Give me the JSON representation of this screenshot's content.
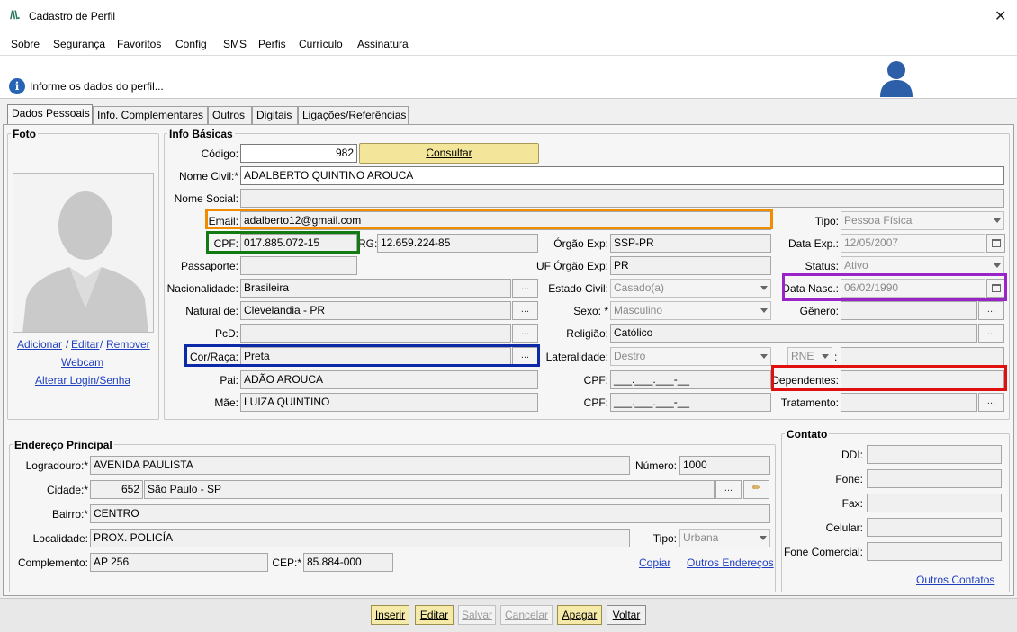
{
  "window": {
    "title": "Cadastro de Perfil",
    "logo": "/\\\\."
  },
  "menu": [
    "Sobre",
    "Segurança",
    "Favoritos",
    "Config",
    "SMS",
    "Perfis",
    "Currículo",
    "Assinatura"
  ],
  "info": {
    "text": "Informe os dados do perfil..."
  },
  "tabs": [
    "Dados Pessoais",
    "Info. Complementares",
    "Outros",
    "Digitais",
    "Ligações/Referências"
  ],
  "foto": {
    "title": "Foto",
    "add": "Adicionar",
    "sep1": "/",
    "edit": "Editar",
    "sep2": "/",
    "remove": "Remover",
    "webcam": "Webcam",
    "change_login": "Alterar Login/Senha"
  },
  "basic": {
    "title": "Info Básicas",
    "codigo_label": "Código:",
    "codigo": "982",
    "consultar": "Consultar",
    "nome_civil_label": "Nome Civil:*",
    "nome_civil": "ADALBERTO QUINTINO AROUCA",
    "nome_social_label": "Nome Social:",
    "nome_social": "",
    "email_label": "Email:",
    "email": "adalberto12@gmail.com",
    "cpf_label": "CPF:",
    "cpf": "017.885.072-15",
    "rg_label": "RG:",
    "rg": "12.659.224-85",
    "passaporte_label": "Passaporte:",
    "passaporte": "",
    "nacionalidade_label": "Nacionalidade:",
    "nacionalidade": "Brasileira",
    "natural_label": "Natural de:",
    "natural": "Clevelandia - PR",
    "pcd_label": "PcD:",
    "pcd": "",
    "cor_label": "Cor/Raça:",
    "cor": "Preta",
    "pai_label": "Pai:",
    "pai": "ADÃO AROUCA",
    "mae_label": "Mãe:",
    "mae": "LUIZA QUINTINO",
    "orgao_label": "Órgão Exp:",
    "orgao": "SSP-PR",
    "uf_label": "UF Órgão Exp:",
    "uf": "PR",
    "estado_civil_label": "Estado Civil:",
    "estado_civil": "Casado(a)",
    "sexo_label": "Sexo: *",
    "sexo": "Masculino",
    "religiao_label": "Religião:",
    "religiao": "Católico",
    "lateralidade_label": "Lateralidade:",
    "lateralidade": "Destro",
    "cpf_pai_label": "CPF:",
    "cpf_pai": "___.___.___-__",
    "cpf_mae_label": "CPF:",
    "cpf_mae": "___.___.___-__",
    "tipo_label": "Tipo:",
    "tipo": "Pessoa Física",
    "data_exp_label": "Data Exp.:",
    "data_exp": "12/05/2007",
    "status_label": "Status:",
    "status": "Ativo",
    "data_nasc_label": "Data Nasc.:",
    "data_nasc": "06/02/1990",
    "genero_label": "Gênero:",
    "genero": "",
    "rne": "RNE",
    "rne_colon": ":",
    "rne_value": "",
    "dependentes_label": "Dependentes:",
    "dependentes": "",
    "tratamento_label": "Tratamento:",
    "tratamento": ""
  },
  "dots": "...",
  "address": {
    "title": "Endereço Principal",
    "logradouro_label": "Logradouro:*",
    "logradouro": "AVENIDA PAULISTA",
    "numero_label": "Número:",
    "numero": "1000",
    "cidade_label": "Cidade:*",
    "cidade_code": "652",
    "cidade": "São Paulo - SP",
    "bairro_label": "Bairro:*",
    "bairro": "CENTRO",
    "localidade_label": "Localidade:",
    "localidade": "PROX. POLICÍA",
    "tipo_label": "Tipo:",
    "tipo": "Urbana",
    "complemento_label": "Complemento:",
    "complemento": "AP 256",
    "cep_label": "CEP:*",
    "cep": "85.884-000",
    "copiar": "Copiar",
    "outros_enderecos": "Outros Endereços"
  },
  "contact": {
    "title": "Contato",
    "ddi_label": "DDI:",
    "fone_label": "Fone:",
    "fax_label": "Fax:",
    "celular_label": "Celular:",
    "fone_com_label": "Fone Comercial:",
    "outros_contatos": "Outros Contatos"
  },
  "buttons": {
    "inserir": "Inserir",
    "editar": "Editar",
    "salvar": "Salvar",
    "cancelar": "Cancelar",
    "apagar": "Apagar",
    "voltar": "Voltar"
  },
  "highlight_colors": {
    "email": "#f08c00",
    "cpf": "#127a12",
    "cor": "#0c2aa8",
    "data_nasc": "#9a24c8",
    "dependentes": "#e01010"
  }
}
